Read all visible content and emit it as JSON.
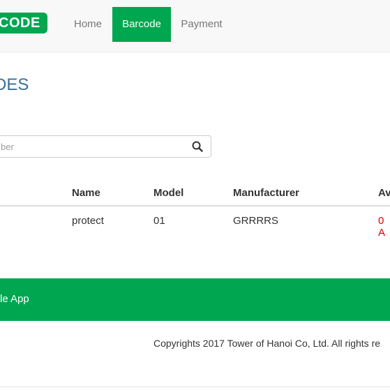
{
  "brand": {
    "logo_text": "CODE"
  },
  "nav": {
    "items": [
      {
        "label": "Home"
      },
      {
        "label": "Barcode",
        "active": true
      },
      {
        "label": "Payment"
      }
    ]
  },
  "page": {
    "heading": "DES"
  },
  "search": {
    "placeholder": "ber",
    "value": "",
    "icon": "search-icon"
  },
  "table": {
    "headers": [
      "Name",
      "Model",
      "Manufacturer",
      "Av"
    ],
    "rows": [
      {
        "name": "protect",
        "model": "01",
        "manufacturer": "GRRRRS",
        "availability": "0 A"
      }
    ]
  },
  "footer": {
    "link_label": "obile App",
    "copyright": "Copyrights 2017 Tower of Hanoi Co, Ltd. All rights re"
  },
  "colors": {
    "brand_green": "#00a650",
    "heading_blue": "#3a6f97",
    "availability_red": "#e00000"
  }
}
